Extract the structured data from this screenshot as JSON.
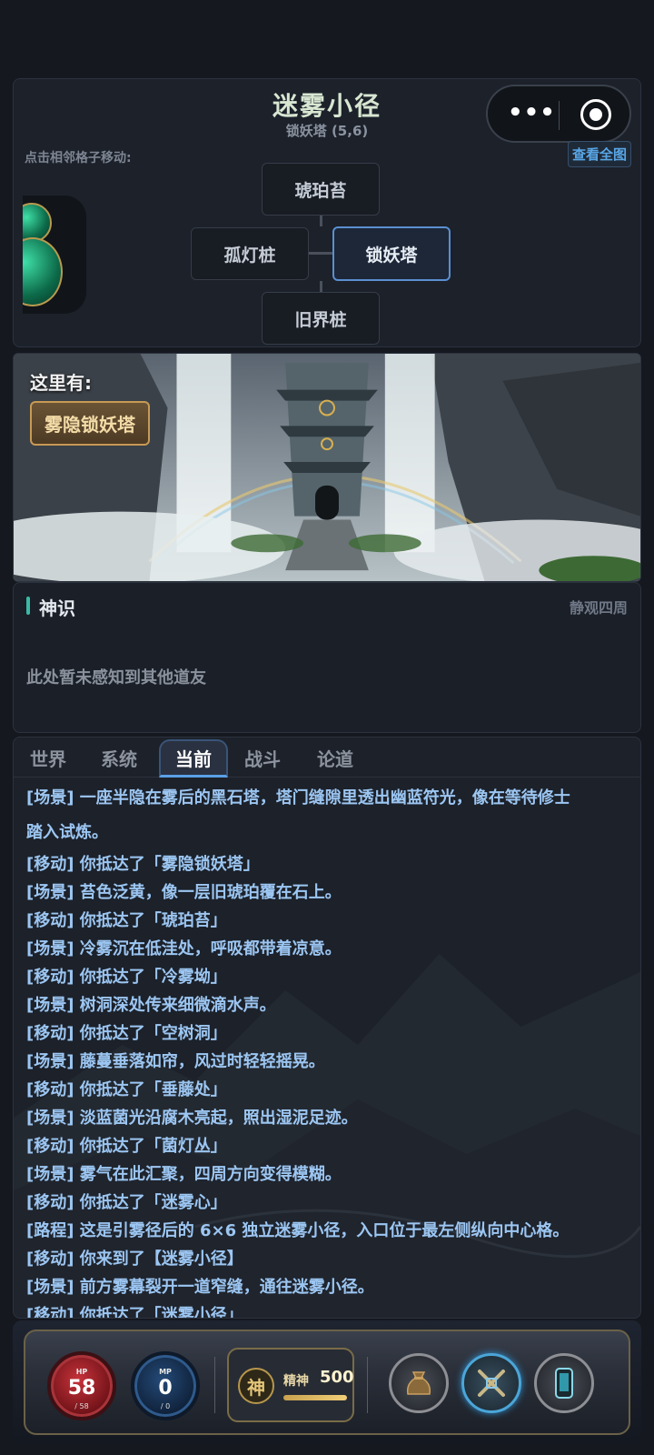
{
  "map": {
    "title": "迷雾小径",
    "location": "锁妖塔 (5,6)",
    "hint": "点击相邻格子移动:",
    "view_full": "查看全图",
    "cells": {
      "north": "琥珀苔",
      "west": "孤灯桩",
      "center": "锁妖塔",
      "south": "旧界桩"
    }
  },
  "capsule": {
    "more_icon": "•••",
    "close_icon": "target-icon"
  },
  "scene": {
    "label": "这里有:",
    "tag": "雾隐锁妖塔"
  },
  "sense": {
    "title": "神识",
    "action": "静观四周",
    "empty": "此处暂未感知到其他道友"
  },
  "tabs": [
    "世界",
    "系统",
    "当前",
    "战斗",
    "论道"
  ],
  "active_tab": "当前",
  "log": [
    "[场景] 一座半隐在雾后的黑石塔，塔门缝隙里透出幽蓝符光，像在等待修士",
    "踏入试炼。",
    "[移动] 你抵达了「雾隐锁妖塔」",
    "[场景] 苔色泛黄，像一层旧琥珀覆在石上。",
    "[移动] 你抵达了「琥珀苔」",
    "[场景] 冷雾沉在低洼处，呼吸都带着凉意。",
    "[移动] 你抵达了「冷雾坳」",
    "[场景] 树洞深处传来细微滴水声。",
    "[移动] 你抵达了「空树洞」",
    "[场景] 藤蔓垂落如帘，风过时轻轻摇晃。",
    "[移动] 你抵达了「垂藤处」",
    "[场景] 淡蓝菌光沿腐木亮起，照出湿泥足迹。",
    "[移动] 你抵达了「菌灯丛」",
    "[场景] 雾气在此汇聚，四周方向变得模糊。",
    "[移动] 你抵达了「迷雾心」",
    "[路程] 这是引雾径后的 6×6 独立迷雾小径，入口位于最左侧纵向中心格。",
    "[移动] 你来到了【迷雾小径】",
    "[场景] 前方雾幕裂开一道窄缝，通往迷雾小径。",
    "[移动] 你抵达了「迷雾小径」"
  ],
  "hud": {
    "hp": {
      "label": "HP",
      "value": "58",
      "max": "/ 58"
    },
    "mp": {
      "label": "MP",
      "value": "0",
      "max": "/ 0"
    },
    "spirit": {
      "seal": "神",
      "label": "精神",
      "value": "500",
      "fill": 1.0
    },
    "icons": [
      "bag-icon",
      "battle-icon",
      "phone-icon"
    ]
  }
}
